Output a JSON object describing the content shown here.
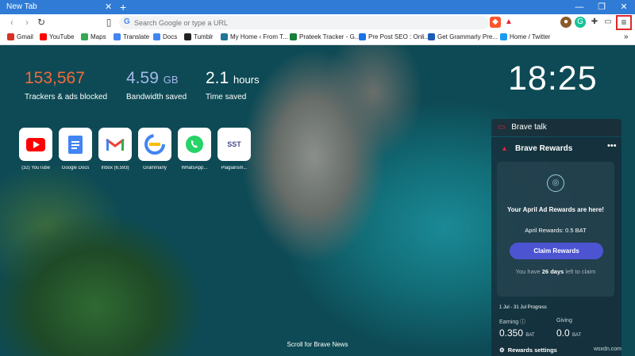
{
  "window": {
    "tab_title": "New Tab",
    "tab_close": "✕",
    "new_tab": "+",
    "minimize": "—",
    "restore": "❐",
    "close": "✕"
  },
  "toolbar": {
    "back": "‹",
    "forward": "›",
    "reload": "↻",
    "bookmark": "▯",
    "omnibox_placeholder": "Search Google or type a URL",
    "menu": "≡"
  },
  "bookmarks": [
    {
      "label": "Gmail",
      "color": "#d93025"
    },
    {
      "label": "YouTube",
      "color": "#ff0000"
    },
    {
      "label": "Maps",
      "color": "#34a853"
    },
    {
      "label": "Translate",
      "color": "#4285f4"
    },
    {
      "label": "Docs",
      "color": "#4285f4"
    },
    {
      "label": "Tumblr",
      "color": "#222222"
    },
    {
      "label": "My Home ‹ From T...",
      "color": "#21759b"
    },
    {
      "label": "Prateek Tracker - G...",
      "color": "#188038"
    },
    {
      "label": "Pre Post SEO : Onli...",
      "color": "#1a73e8"
    },
    {
      "label": "Get Grammarly Pre...",
      "color": "#1a5cb6"
    },
    {
      "label": "Home / Twitter",
      "color": "#1d9bf0"
    }
  ],
  "bookmarks_overflow": "»",
  "stats": {
    "trackers": {
      "value": "153,567",
      "label": "Trackers & ads blocked",
      "color": "#f26a3c"
    },
    "bandwidth": {
      "value": "4.59",
      "unit": "GB",
      "label": "Bandwidth saved",
      "color": "#a8b8ec"
    },
    "time": {
      "value": "2.1",
      "unit": "hours",
      "label": "Time saved",
      "color": "#ffffff"
    }
  },
  "clock": "18:25",
  "top_sites": [
    {
      "label": "(32) YouTube"
    },
    {
      "label": "Google Docs"
    },
    {
      "label": "Inbox (6,593)"
    },
    {
      "label": "Grammarly"
    },
    {
      "label": "WhatsApp..."
    },
    {
      "label": "Plagiarism..."
    }
  ],
  "sst_text": "SST",
  "brave_talk": {
    "title": "Brave talk"
  },
  "rewards": {
    "title": "Brave Rewards",
    "more": "•••",
    "card_title": "Your April Ad Rewards are here!",
    "april_rewards": "April Rewards: 0.5 BAT",
    "claim_button": "Claim Rewards",
    "days_prefix": "You have",
    "days": "26 days",
    "days_suffix": "left to claim",
    "progress_label": "1 Jul - 31 Jul Progress",
    "earning_label": "Earning ⓘ",
    "earning_value": "0.350",
    "giving_label": "Giving",
    "giving_value": "0.0",
    "unit": "BAT",
    "settings": "Rewards settings"
  },
  "scroll_news": "Scroll for Brave News",
  "watermark": "wsxdn.com"
}
